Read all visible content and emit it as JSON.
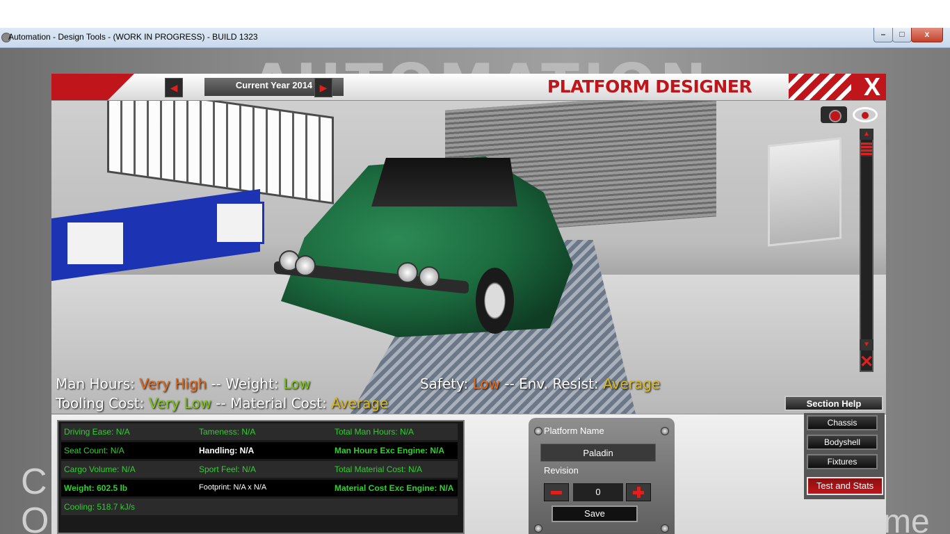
{
  "window": {
    "title": "Automation - Design Tools - (WORK IN PROGRESS) - BUILD 1323",
    "min_symbol": "–",
    "max_symbol": "□",
    "close_symbol": "x"
  },
  "background": {
    "logo_text": "AUTOMATION",
    "left_text": "C\nO",
    "right_text": "me"
  },
  "header": {
    "current_year_label": "Current Year 2014",
    "prev_arrow": "◀",
    "next_arrow": "▶",
    "title": "PLATFORM DESIGNER",
    "close_label": "X"
  },
  "viewport_controls": {
    "zoom_up": "▲",
    "zoom_down": "▼",
    "reset_symbol": "✕",
    "icons": [
      "camera-icon",
      "eye-icon",
      "reset-view-icon"
    ]
  },
  "summary": {
    "man_hours_label": "Man Hours:",
    "man_hours_value": "Very High",
    "sep1": "--",
    "weight_label": "Weight:",
    "weight_value": "Low",
    "safety_label": "Safety:",
    "safety_value": "Low",
    "sep2": "--",
    "env_label": "Env. Resist:",
    "env_value": "Average",
    "tooling_label": "Tooling Cost:",
    "tooling_value": "Very Low",
    "sep3": "--",
    "material_label": "Material Cost:",
    "material_value": "Average"
  },
  "section_help": "Section Help",
  "stats": [
    [
      "Driving Ease: N/A",
      "Tameness: N/A",
      "Total Man Hours: N/A"
    ],
    [
      "Seat Count: N/A",
      "Handling: N/A",
      "Man Hours Exc Engine: N/A"
    ],
    [
      "Cargo Volume: N/A",
      "Sport Feel: N/A",
      "Total Material Cost: N/A"
    ],
    [
      "Weight: 602.5 lb",
      "Footprint: N/A x N/A",
      "Material Cost Exc Engine: N/A"
    ],
    [
      "Cooling: 518.7 kJ/s",
      "",
      ""
    ]
  ],
  "platform": {
    "name_label": "Platform Name",
    "name_value": "Paladin",
    "revision_label": "Revision",
    "revision_value": "0",
    "save_label": "Save"
  },
  "side_menu": {
    "chassis": "Chassis",
    "bodyshell": "Bodyshell",
    "fixtures": "Fixtures",
    "test_and_stats": "Test and Stats"
  },
  "colors": {
    "accent_red": "#c0151b",
    "value_orange": "#e36a1a",
    "value_green": "#7ec71a",
    "value_yellow": "#d9b820",
    "stat_green": "#2fd02f"
  }
}
